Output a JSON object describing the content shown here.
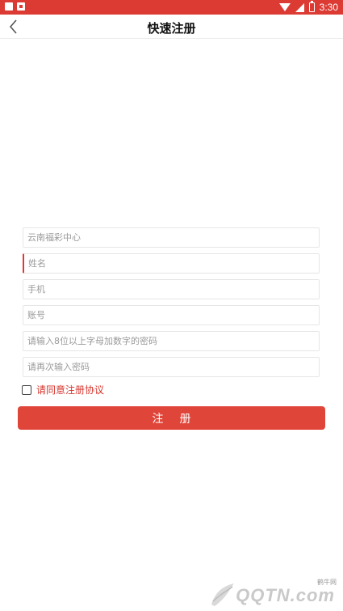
{
  "status_bar": {
    "time": "3:30",
    "colors": {
      "background": "#dc3b34"
    }
  },
  "header": {
    "title": "快速注册",
    "back_icon": "chevron-left-icon"
  },
  "form": {
    "organization": {
      "value": "",
      "placeholder": "云南福彩中心"
    },
    "name": {
      "value": "",
      "placeholder": "姓名"
    },
    "phone": {
      "value": "",
      "placeholder": "手机"
    },
    "account": {
      "value": "",
      "placeholder": "账号"
    },
    "password": {
      "value": "",
      "placeholder": "请输入8位以上字母加数字的密码"
    },
    "password_confirm": {
      "value": "",
      "placeholder": "请再次输入密码"
    }
  },
  "agreement": {
    "checked": false,
    "label": "请同意注册协议"
  },
  "submit": {
    "label": "注册"
  },
  "watermark": {
    "small": "鹤牛网",
    "brand": "QQTN.com"
  },
  "colors": {
    "accent": "#e0453a",
    "agreement_text": "#d4342c"
  }
}
